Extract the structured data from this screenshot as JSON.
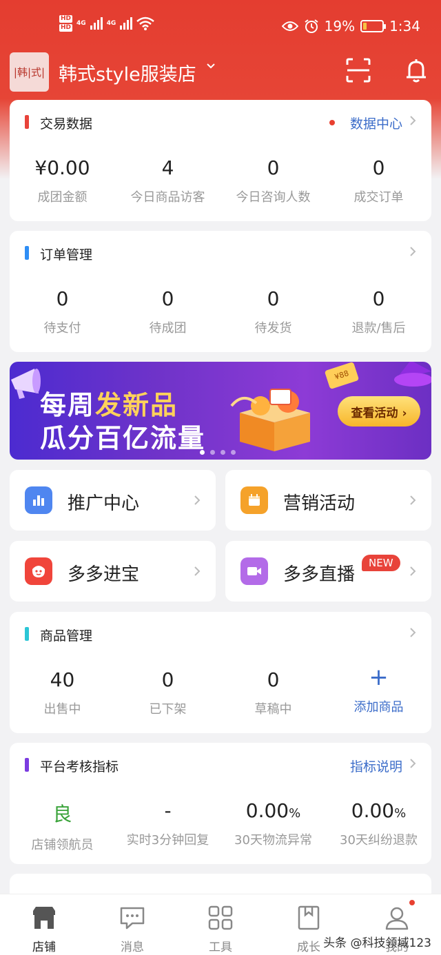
{
  "status_bar": {
    "hd1": "HD",
    "hd2": "HD",
    "net1": "4G",
    "net2": "4G",
    "battery_pct": "19%",
    "battery_level": 0.19,
    "time": "1:34"
  },
  "header": {
    "logo_text": "|韩|式|",
    "store_name": "韩式style服装店"
  },
  "trade_card": {
    "title": "交易数据",
    "link": "数据中心",
    "stats": [
      {
        "value": "¥0.00",
        "label": "成团金额"
      },
      {
        "value": "4",
        "label": "今日商品访客"
      },
      {
        "value": "0",
        "label": "今日咨询人数"
      },
      {
        "value": "0",
        "label": "成交订单"
      }
    ]
  },
  "order_card": {
    "title": "订单管理",
    "stats": [
      {
        "value": "0",
        "label": "待支付"
      },
      {
        "value": "0",
        "label": "待成团"
      },
      {
        "value": "0",
        "label": "待发货"
      },
      {
        "value": "0",
        "label": "退款/售后"
      }
    ]
  },
  "banner": {
    "line1_a": "每周",
    "line1_b": "发新品",
    "line2": "瓜分百亿流量",
    "button": "查看活动 ›",
    "ticket": "¥88"
  },
  "tiles": [
    {
      "label": "推广中心",
      "color": "#4f86f0"
    },
    {
      "label": "营销活动",
      "color": "#f5a22a"
    },
    {
      "label": "多多进宝",
      "color": "#f0453b"
    },
    {
      "label": "多多直播",
      "color": "#b36be8",
      "badge": "NEW"
    }
  ],
  "goods_card": {
    "title": "商品管理",
    "stats": [
      {
        "value": "40",
        "label": "出售中"
      },
      {
        "value": "0",
        "label": "已下架"
      },
      {
        "value": "0",
        "label": "草稿中"
      },
      {
        "value": "+",
        "label": "添加商品"
      }
    ]
  },
  "metrics_card": {
    "title": "平台考核指标",
    "link": "指标说明",
    "stats": [
      {
        "value": "良",
        "label": "店铺领航员"
      },
      {
        "value": "-",
        "label": "实时3分钟回复"
      },
      {
        "value": "0.00",
        "unit": "%",
        "label": "30天物流异常"
      },
      {
        "value": "0.00",
        "unit": "%",
        "label": "30天纠纷退款"
      }
    ]
  },
  "bottom_nav": [
    {
      "label": "店铺"
    },
    {
      "label": "消息"
    },
    {
      "label": "工具"
    },
    {
      "label": "成长"
    },
    {
      "label": "我的"
    }
  ],
  "watermark": "头条 @科技领域123"
}
